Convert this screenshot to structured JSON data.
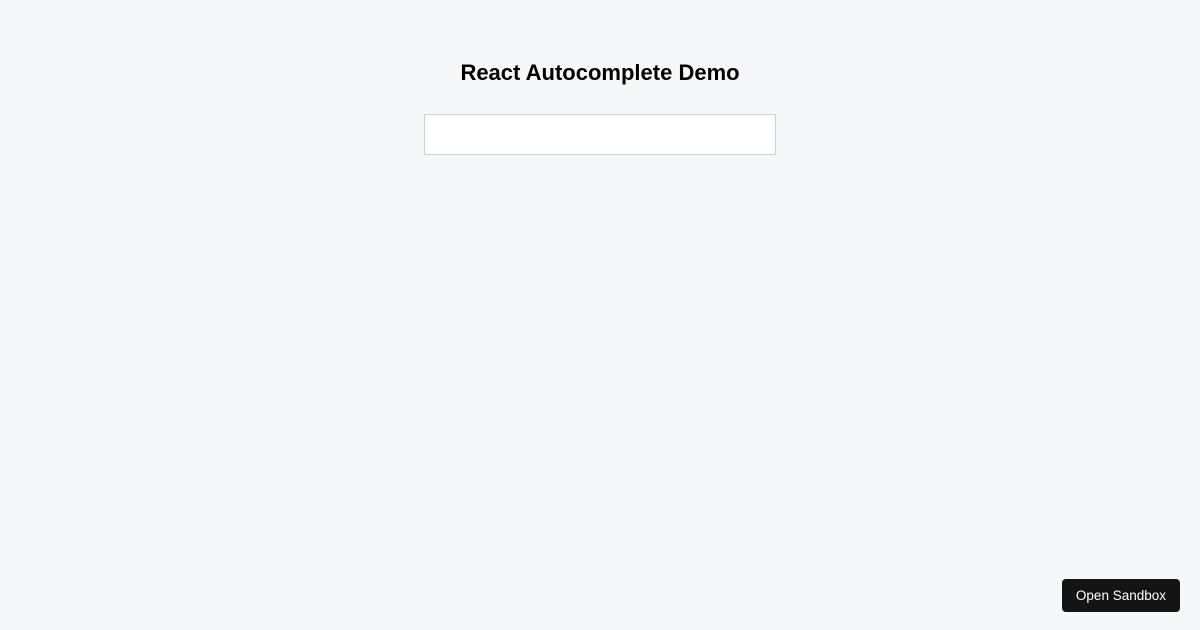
{
  "header": {
    "title": "React Autocomplete Demo"
  },
  "form": {
    "autocomplete_value": "",
    "autocomplete_placeholder": ""
  },
  "footer": {
    "open_sandbox_label": "Open Sandbox"
  }
}
